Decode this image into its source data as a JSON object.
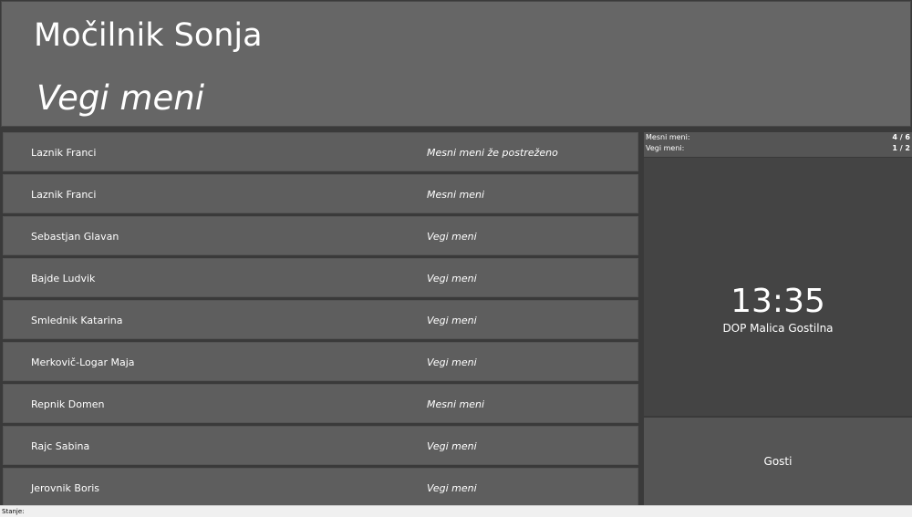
{
  "header": {
    "name": "Močilnik Sonja",
    "menu": "Vegi meni"
  },
  "orders": [
    {
      "name": "Laznik Franci",
      "meal": "Mesni meni že postreženo"
    },
    {
      "name": "Laznik Franci",
      "meal": "Mesni meni"
    },
    {
      "name": "Sebastjan Glavan",
      "meal": "Vegi meni"
    },
    {
      "name": "Bajde Ludvik",
      "meal": "Vegi meni"
    },
    {
      "name": "Smlednik Katarina",
      "meal": "Vegi meni"
    },
    {
      "name": "Merkovič-Logar Maja",
      "meal": "Vegi meni"
    },
    {
      "name": "Repnik Domen",
      "meal": "Mesni meni"
    },
    {
      "name": "Rajc Sabina",
      "meal": "Vegi meni"
    },
    {
      "name": "Jerovnik Boris",
      "meal": "Vegi meni"
    }
  ],
  "counts": {
    "meat": {
      "label": "Mesni meni:",
      "value": "4 / 6"
    },
    "veg": {
      "label": "Vegi meni:",
      "value": "1 / 2"
    }
  },
  "clock": {
    "time": "13:35",
    "location": "DOP Malica Gostilna"
  },
  "guests_button": "Gosti",
  "status": {
    "label": "Stanje:"
  },
  "colors": {
    "header_bg": "#666666",
    "row_bg": "#5e5e5e",
    "panel_bg": "#444444",
    "status_bg": "#f0f0f0"
  }
}
